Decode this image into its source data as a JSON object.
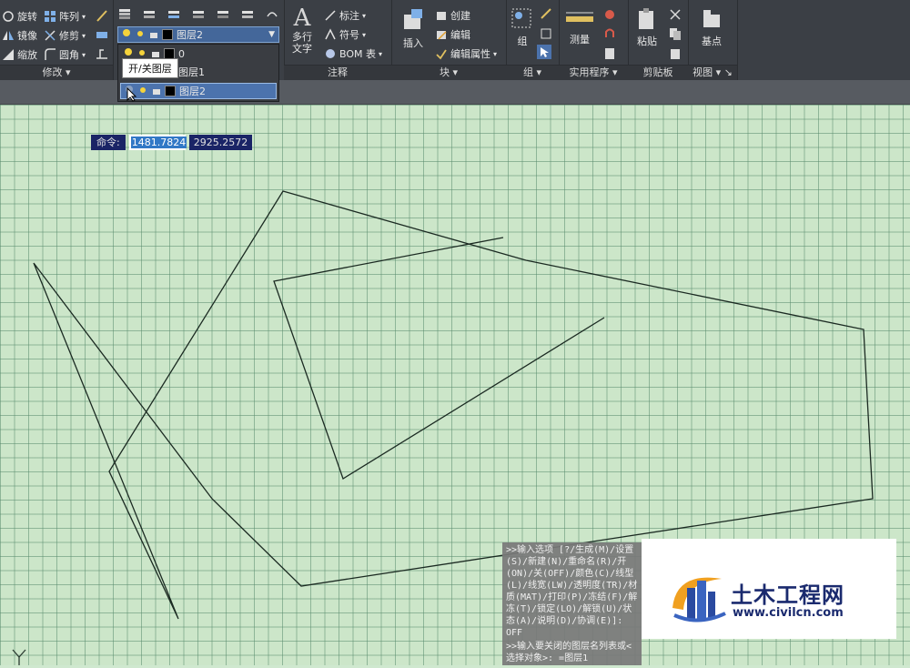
{
  "modify_panel": {
    "title": "修改",
    "rotate": "旋转",
    "array": "阵列",
    "mirror": "镜像",
    "trim": "修剪",
    "scale": "缩放",
    "fillet": "圆角"
  },
  "layers_panel": {
    "current_layer": "图层2",
    "tooltip": "开/关图层",
    "layers": [
      {
        "name": "0"
      },
      {
        "name": "图层1"
      },
      {
        "name": "图层2"
      }
    ]
  },
  "annotation_panel": {
    "title": "注释",
    "mtext": "多行\n文字",
    "dimension": "标注",
    "symbol": "符号",
    "bom_table": "BOM 表"
  },
  "block_panel": {
    "title": "块",
    "insert": "插入",
    "create": "创建",
    "edit": "编辑",
    "edit_attributes": "编辑属性"
  },
  "group_panel": {
    "title": "组",
    "group": "组"
  },
  "utilities_panel": {
    "title": "实用程序",
    "measure": "测量"
  },
  "clipboard_panel": {
    "title": "剪贴板",
    "paste": "粘贴"
  },
  "view_panel": {
    "title": "视图",
    "base": "基点"
  },
  "coord_input": {
    "label": "命令:",
    "x_value": "1481.7824",
    "y_value": "2925.2572"
  },
  "command_history": [
    ">>输入选项 [?/生成(M)/设置(S)/新建(N)/重命名(R)/开(ON)/关(OFF)/颜色(C)/线型(L)/线宽(LW)/透明度(TR)/材质(MAT)/打印(P)/冻结(F)/解冻(T)/锁定(LO)/解锁(U)/状态(A)/说明(D)/协调(E)]: OFF",
    ">>输入要关闭的图层名列表或<选择对象>: =图层1"
  ],
  "watermark": {
    "text": "土木工程网",
    "url": "www.civilcn.com"
  },
  "colors": {
    "ribbon_bg": "#3b3f45",
    "canvas_bg": "#cce6c9",
    "grid": "#5a8c6e",
    "line": "#1b2a22",
    "selection": "#4c73ad"
  }
}
